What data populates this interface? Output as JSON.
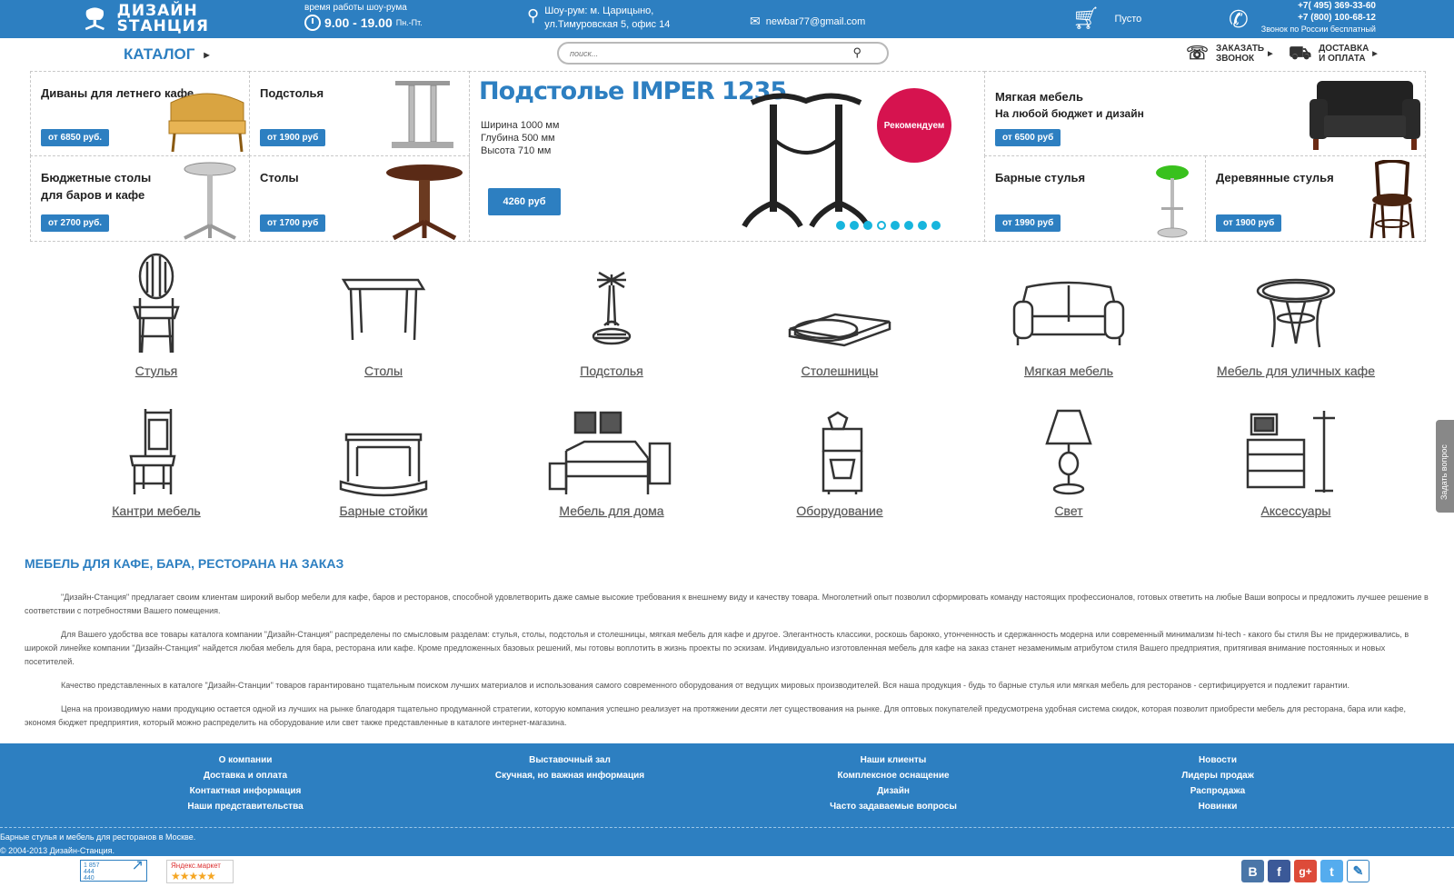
{
  "header": {
    "logo_line1": "ДИЗАЙН",
    "logo_line2": "STАНЦИЯ",
    "hours_label": "время работы шоу-рума",
    "hours_time": "9.00 - 19.00",
    "hours_days": "Пн.-Пт.",
    "address_line1": "Шоу-рум: м. Царицыно,",
    "address_line2": "ул.Тимуровская 5, офис 14",
    "email": "newbar77@gmail.com",
    "cart_status": "Пусто",
    "phone1": "+7( 495) 369-33-60",
    "phone2": "+7 (800) 100-68-12",
    "phone_note": "Звонок по России бесплатный"
  },
  "subheader": {
    "catalog_label": "КАТАЛОГ",
    "search_placeholder": "поиск...",
    "callback_line1": "ЗАКАЗАТЬ",
    "callback_line2": "ЗВОНОК",
    "delivery_line1": "ДОСТАВКА",
    "delivery_line2": "И ОПЛАТА"
  },
  "promo": {
    "tiles": [
      {
        "title": "Диваны для летнего кафе",
        "price": "от 6850 руб."
      },
      {
        "title": "Подстолья",
        "price": "от 1900 руб"
      },
      {
        "title": "Бюджетные столы для баров и кафе",
        "price": "от 2700 руб."
      },
      {
        "title": "Столы",
        "price": "от 1700 руб"
      },
      {
        "title": "Мягкая мебель",
        "subtitle": "На любой бюджет и дизайн",
        "price": "от 6500 руб"
      },
      {
        "title": "Барные стулья",
        "price": "от 1990 руб"
      },
      {
        "title": "Деревянные стулья",
        "price": "от 1900 руб"
      }
    ],
    "feature": {
      "title": "Подстолье IMPER 1235",
      "spec1": "Ширина 1000 мм",
      "spec2": "Глубина 500 мм",
      "spec3": "Высота 710 мм",
      "price": "4260 руб",
      "badge": "Рекомендуем"
    }
  },
  "categories": [
    {
      "label": "Стулья",
      "icon": "chair-icon"
    },
    {
      "label": "Столы",
      "icon": "table-icon"
    },
    {
      "label": "Подстолья",
      "icon": "table-base-icon"
    },
    {
      "label": "Столешницы",
      "icon": "tabletop-icon"
    },
    {
      "label": "Мягкая мебель",
      "icon": "sofa-icon"
    },
    {
      "label": "Мебель для уличных кафе",
      "icon": "outdoor-table-icon"
    },
    {
      "label": "Кантри мебель",
      "icon": "country-chair-icon"
    },
    {
      "label": "Барные стойки",
      "icon": "bar-counter-icon"
    },
    {
      "label": "Мебель для дома",
      "icon": "bed-icon"
    },
    {
      "label": "Оборудование",
      "icon": "coffee-machine-icon"
    },
    {
      "label": "Свет",
      "icon": "lamp-icon"
    },
    {
      "label": "Аксессуары",
      "icon": "dresser-icon"
    }
  ],
  "seo": {
    "heading": "МЕБЕЛЬ ДЛЯ КАФЕ, БАРА, РЕСТОРАНА НА ЗАКАЗ",
    "p1": "\"Дизайн-Станция\" предлагает своим клиентам широкий выбор мебели для кафе, баров и ресторанов,  способной удовлетворить даже самые высокие требования к внешнему виду и качеству товара. Многолетний опыт позволил сформировать команду настоящих профессионалов, готовых ответить на любые Ваши вопросы и предложить лучшее решение в соответствии с потребностями Вашего помещения.",
    "p2": "Для Вашего удобства все товары каталога компании \"Дизайн-Станция\" распределены по смысловым разделам: стулья, столы, подстолья и столешницы, мягкая мебель для кафе и другое. Элегантность классики, роскошь барокко, утонченность и сдержанность модерна или современный минимализм hi-tech - какого бы стиля Вы не придерживались, в широкой линейке компании \"Дизайн-Станция\" найдется любая мебель для бара, ресторана или кафе. Кроме предложенных базовых решений, мы готовы воплотить в жизнь проекты по эскизам. Индивидуально изготовленная мебель для кафе на заказ станет незаменимым атрибутом стиля Вашего предприятия, притягивая внимание постоянных и новых посетителей.",
    "p3": "Качество представленных в каталоге \"Дизайн-Станции\" товаров гарантировано тщательным поиском лучших материалов и использования самого современного оборудования от ведущих мировых производителей.  Вся наша продукция - будь то барные стулья или мягкая мебель для ресторанов - сертифицируется и подлежит гарантии.",
    "p4": "Цена на производимую нами продукцию остается одной из лучших на рынке благодаря тщательно продуманной стратегии, которую компания успешно реализует на протяжении десяти лет существования на рынке. Для оптовых покупателей предусмотрена удобная система скидок, которая позволит приобрести мебель для ресторана, бара или кафе, экономя бюджет предприятия, который можно распределить на оборудование или свет также представленные в каталоге интернет-магазина."
  },
  "footer": {
    "col1": [
      "О компании",
      "Доставка и оплата",
      "Контактная информация",
      "Наши представительства"
    ],
    "col2": [
      "Выставочный зал",
      "Скучная, но важная информация"
    ],
    "col3": [
      "Наши клиенты",
      "Комплексное оснащение",
      "Дизайн",
      "Часто задаваемые вопросы"
    ],
    "col4": [
      "Новости",
      "Лидеры продаж",
      "Распродажа",
      "Новинки"
    ],
    "copy1": "Барные стулья и мебель для ресторанов в Москве.",
    "copy2": "© 2004-2013 Дизайн-Станция."
  },
  "badges": {
    "counter_lines": [
      "1 857",
      "444",
      "440"
    ],
    "yandex_label": "Яндекс.маркет",
    "yandex_stars": "★★★★★"
  },
  "social": [
    "В",
    "f",
    "g+",
    "t",
    "✎"
  ],
  "side_tab": "Задать вопрос",
  "colors": {
    "brand": "#2d7fc1",
    "badge": "#d6134f",
    "dots": "#17b5dd"
  }
}
